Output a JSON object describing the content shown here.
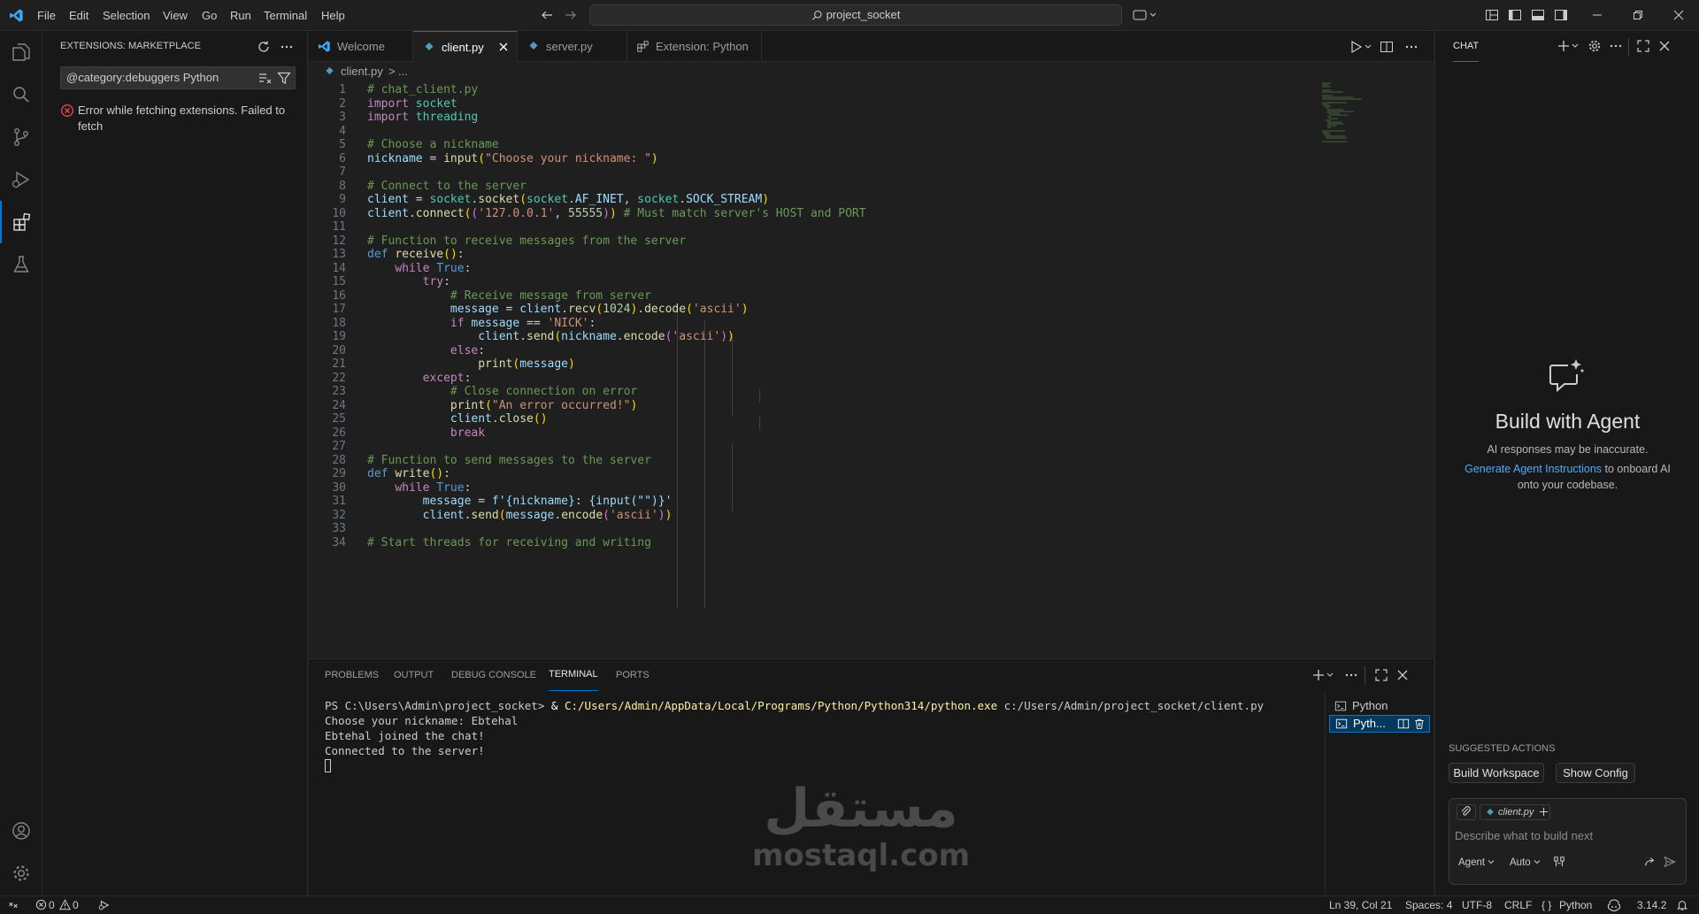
{
  "titlebar": {
    "menu": [
      "File",
      "Edit",
      "Selection",
      "View",
      "Go",
      "Run",
      "Terminal",
      "Help"
    ],
    "search_text": "project_socket"
  },
  "sidebar": {
    "title": "EXTENSIONS: MARKETPLACE",
    "search_value": "@category:debuggers Python",
    "error_line1": "Error while fetching extensions. Failed to",
    "error_line2": "fetch"
  },
  "tabs": [
    {
      "label": "Welcome"
    },
    {
      "label": "client.py"
    },
    {
      "label": "server.py"
    },
    {
      "label": "Extension: Python"
    }
  ],
  "breadcrumb": {
    "file": "client.py",
    "sep": ">",
    "rest": "..."
  },
  "code_lines": [
    "# chat_client.py",
    "import socket",
    "import threading",
    "",
    "# Choose a nickname",
    "nickname = input(\"Choose your nickname: \")",
    "",
    "# Connect to the server",
    "client = socket.socket(socket.AF_INET, socket.SOCK_STREAM)",
    "client.connect(('127.0.0.1', 55555)) # Must match server's HOST and PORT",
    "",
    "# Function to receive messages from the server",
    "def receive():",
    "    while True:",
    "        try:",
    "            # Receive message from server",
    "            message = client.recv(1024).decode('ascii')",
    "            if message == 'NICK':",
    "                client.send(nickname.encode('ascii'))",
    "            else:",
    "                print(message)",
    "        except:",
    "            # Close connection on error",
    "            print(\"An error occurred!\")",
    "            client.close()",
    "            break",
    "",
    "# Function to send messages to the server",
    "def write():",
    "    while True:",
    "        message = f'{nickname}: {input(\"\")}'",
    "        client.send(message.encode('ascii'))",
    "",
    "# Start threads for receiving and writing"
  ],
  "panel": {
    "tabs": [
      "PROBLEMS",
      "OUTPUT",
      "DEBUG CONSOLE",
      "TERMINAL",
      "PORTS"
    ],
    "terminal_prompt": "PS C:\\Users\\Admin\\project_socket> ",
    "terminal_amp": "& ",
    "terminal_exe": "C:/Users/Admin/AppData/Local/Programs/Python/Python314/python.exe",
    "terminal_arg": " c:/Users/Admin/project_socket/client.py",
    "terminal_lines": [
      "Choose your nickname: Ebtehal",
      "Ebtehal joined the chat!",
      "Connected to the server!"
    ],
    "terminal_list": [
      "Python",
      "Pyth..."
    ]
  },
  "chat": {
    "header": "CHAT",
    "title": "Build with Agent",
    "subtitle": "AI responses may be inaccurate.",
    "link": "Generate Agent Instructions",
    "link_rest": " to onboard AI",
    "line3": "onto your codebase.",
    "suggested": "SUGGESTED ACTIONS",
    "actions": [
      "Build Workspace",
      "Show Config"
    ],
    "context_file": "client.py",
    "input_placeholder": "Describe what to build next",
    "mode": "Agent",
    "model": "Auto"
  },
  "watermark": {
    "arabic": "مستقل",
    "latin": "mostaql.com"
  },
  "status": {
    "errors": "0",
    "warnings": "0",
    "position": "Ln 39, Col 21",
    "spaces": "Spaces: 4",
    "encoding": "UTF-8",
    "eol": "CRLF",
    "language": "Python",
    "version": "3.14.2"
  },
  "colors": {
    "accent": "#0078d4",
    "error": "#f14c4c",
    "link": "#4daafc"
  }
}
